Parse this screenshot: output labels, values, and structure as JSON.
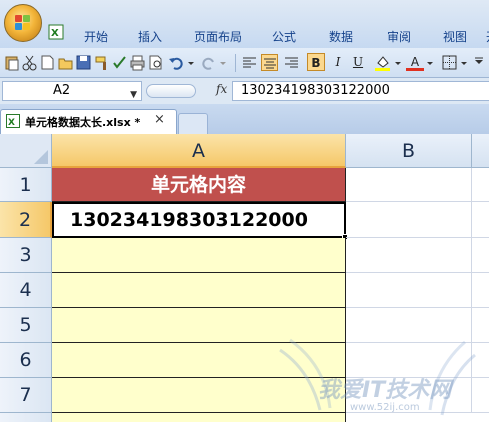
{
  "ribbon": {
    "tabs": [
      "开始",
      "插入",
      "页面布局",
      "公式",
      "数据",
      "审阅",
      "视图",
      "开"
    ]
  },
  "toolbar": {
    "icons": [
      "paste-icon",
      "cut-icon",
      "new-icon",
      "open-icon",
      "save-icon",
      "format-painter-icon",
      "print-icon",
      "print-preview-icon",
      "undo-icon",
      "redo-icon",
      "align-left-icon",
      "align-center-icon",
      "align-right-icon",
      "bold-icon",
      "italic-icon",
      "underline-icon",
      "fill-color-icon",
      "font-color-icon",
      "borders-icon",
      "more-icon"
    ],
    "bold": "B",
    "italic": "I",
    "underline": "U",
    "font_color_letter": "A"
  },
  "formula_bar": {
    "name_box": "A2",
    "fx_label": "fx",
    "content": "130234198303122000"
  },
  "document_tab": {
    "name": "单元格数据太长.xlsx *",
    "close": "×"
  },
  "sheet": {
    "columns": [
      "A",
      "B"
    ],
    "rows": [
      "1",
      "2",
      "3",
      "4",
      "5",
      "6",
      "7"
    ],
    "cells": {
      "A1": "单元格内容",
      "A2": "130234198303122000"
    },
    "active_cell": "A2",
    "colors": {
      "header_fill": "#c0504d",
      "data_fill": "#ffffcc"
    }
  },
  "watermark": {
    "text": "我爱IT技术网",
    "sub": "www.52ij.com"
  }
}
